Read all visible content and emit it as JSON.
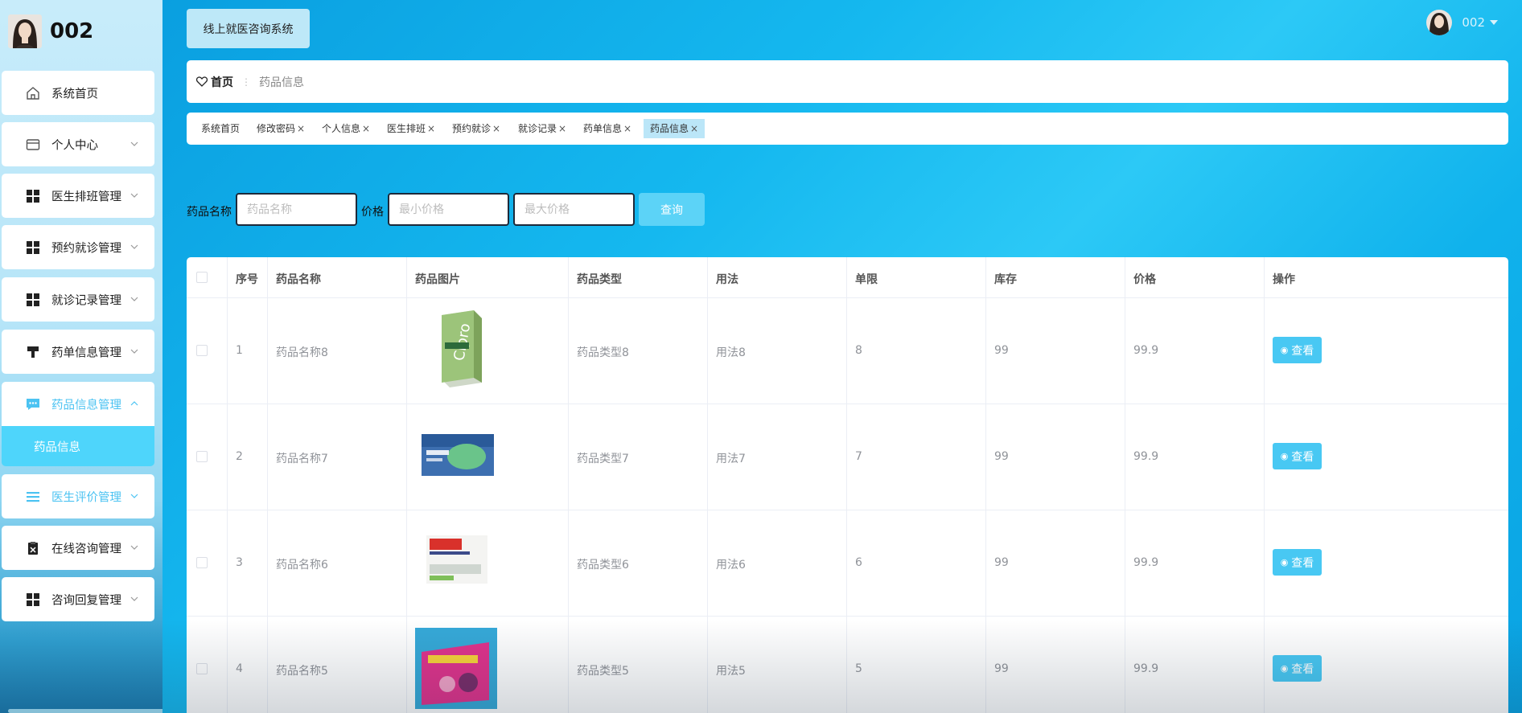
{
  "brand": {
    "name": "002"
  },
  "sidebar": {
    "items": [
      {
        "label": "系统首页",
        "icon": "home-icon"
      },
      {
        "label": "个人中心",
        "icon": "card-icon"
      },
      {
        "label": "医生排班管理",
        "icon": "grid-icon"
      },
      {
        "label": "预约就诊管理",
        "icon": "grid-icon"
      },
      {
        "label": "就诊记录管理",
        "icon": "grid-icon"
      },
      {
        "label": "药单信息管理",
        "icon": "brush-icon"
      },
      {
        "label": "药品信息管理",
        "icon": "chat-icon"
      },
      {
        "label": "医生评价管理",
        "icon": "list-icon"
      },
      {
        "label": "在线咨询管理",
        "icon": "clipboard-icon"
      },
      {
        "label": "咨询回复管理",
        "icon": "grid-icon"
      }
    ],
    "submenu": {
      "label": "药品信息"
    }
  },
  "header": {
    "system_title": "线上就医咨询系统",
    "user": "002"
  },
  "breadcrumb": {
    "home": "首页",
    "current": "药品信息"
  },
  "tags": [
    {
      "label": "系统首页",
      "closable": false
    },
    {
      "label": "修改密码",
      "closable": true
    },
    {
      "label": "个人信息",
      "closable": true
    },
    {
      "label": "医生排班",
      "closable": true
    },
    {
      "label": "预约就诊",
      "closable": true
    },
    {
      "label": "就诊记录",
      "closable": true
    },
    {
      "label": "药单信息",
      "closable": true
    },
    {
      "label": "药品信息",
      "closable": true,
      "active": true
    }
  ],
  "search": {
    "name_label": "药品名称",
    "name_placeholder": "药品名称",
    "price_label": "价格",
    "min_placeholder": "最小价格",
    "max_placeholder": "最大价格",
    "query_button": "查询"
  },
  "table": {
    "columns": [
      "序号",
      "药品名称",
      "药品图片",
      "药品类型",
      "用法",
      "单限",
      "库存",
      "价格",
      "操作"
    ],
    "rows": [
      {
        "index": "1",
        "name": "药品名称8",
        "type": "药品类型8",
        "usage": "用法8",
        "limit": "8",
        "stock": "99",
        "price": "99.9",
        "action": "查看"
      },
      {
        "index": "2",
        "name": "药品名称7",
        "type": "药品类型7",
        "usage": "用法7",
        "limit": "7",
        "stock": "99",
        "price": "99.9",
        "action": "查看"
      },
      {
        "index": "3",
        "name": "药品名称6",
        "type": "药品类型6",
        "usage": "用法6",
        "limit": "6",
        "stock": "99",
        "price": "99.9",
        "action": "查看"
      },
      {
        "index": "4",
        "name": "药品名称5",
        "type": "药品类型5",
        "usage": "用法5",
        "limit": "5",
        "stock": "99",
        "price": "99.9",
        "action": "查看"
      }
    ]
  },
  "colors": {
    "accent": "#4ed5fb",
    "button": "#48c8f3",
    "sidebar": "#c8ecfa"
  }
}
